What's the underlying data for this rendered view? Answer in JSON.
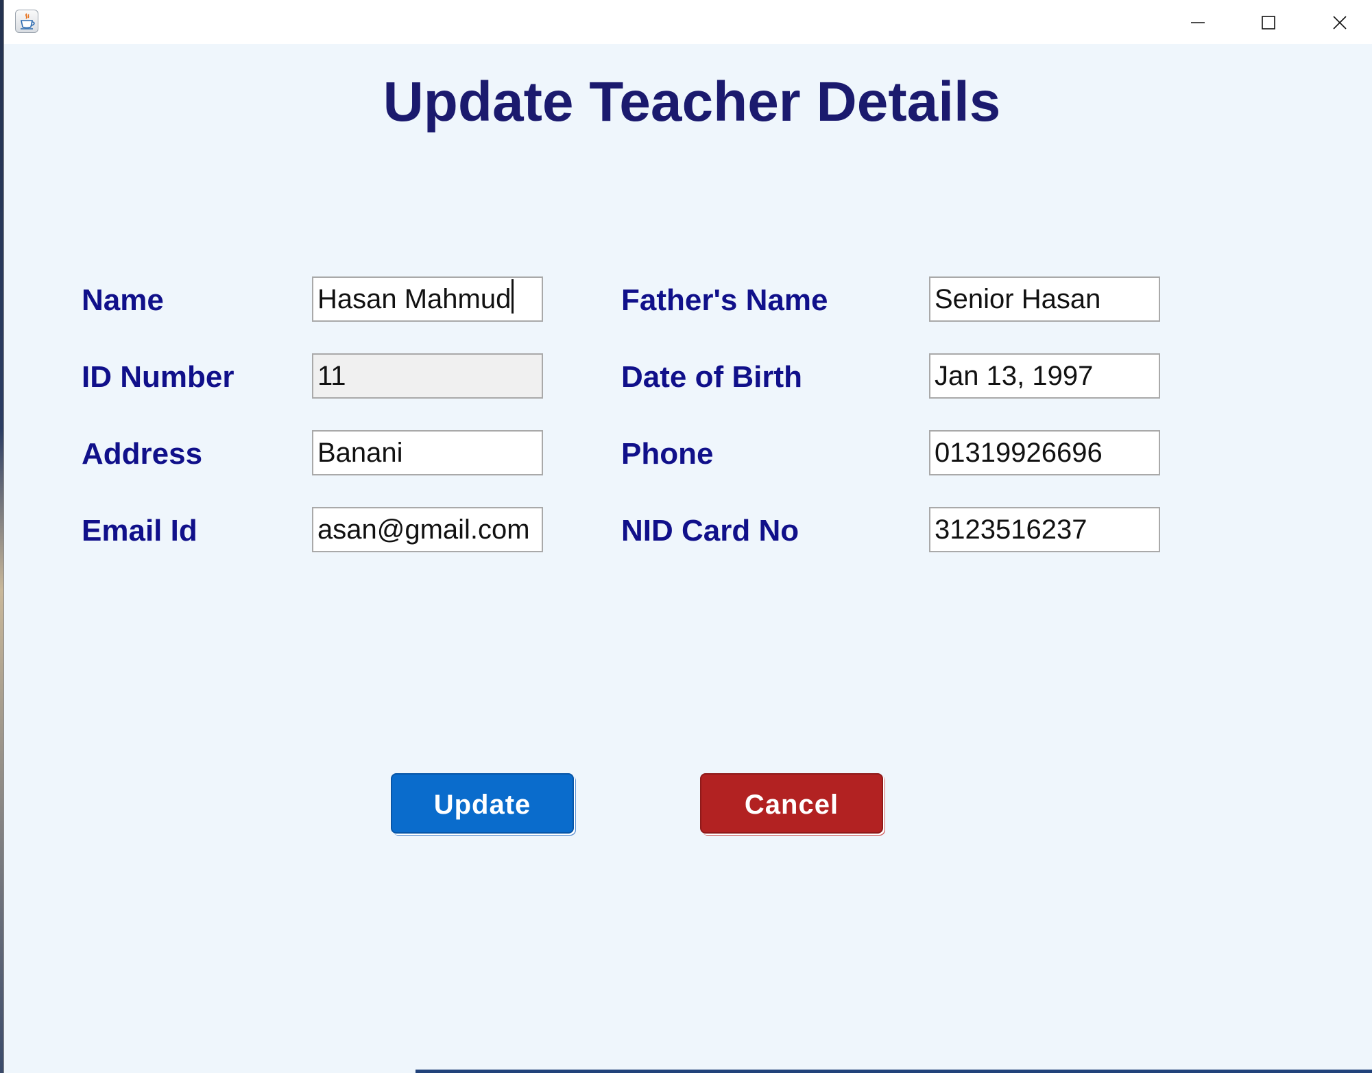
{
  "window": {
    "app_icon": "java-coffee-cup-icon",
    "controls": {
      "minimize_icon": "minimize-icon",
      "maximize_icon": "maximize-icon",
      "close_icon": "close-icon"
    }
  },
  "form": {
    "title": "Update Teacher Details",
    "left_fields": [
      {
        "label": "Name",
        "value": "Hasan Mahmud",
        "editable": true,
        "focused": true
      },
      {
        "label": "ID Number",
        "value": "11",
        "editable": false
      },
      {
        "label": "Address",
        "value": "Banani",
        "editable": true
      },
      {
        "label": "Email Id",
        "value": "asan@gmail.com",
        "editable": true
      }
    ],
    "right_fields": [
      {
        "label": "Father's Name",
        "value": "Senior Hasan",
        "editable": true
      },
      {
        "label": "Date of Birth",
        "value": "Jan 13, 1997",
        "editable": true
      },
      {
        "label": "Phone",
        "value": "01319926696",
        "editable": true
      },
      {
        "label": "NID Card No",
        "value": "3123516237",
        "editable": true
      }
    ]
  },
  "buttons": {
    "update_label": "Update",
    "cancel_label": "Cancel"
  },
  "colors": {
    "title": "#1b1a6e",
    "label": "#10108a",
    "background": "#eff6fc",
    "update_button": "#0a6ccc",
    "cancel_button": "#b22222"
  }
}
